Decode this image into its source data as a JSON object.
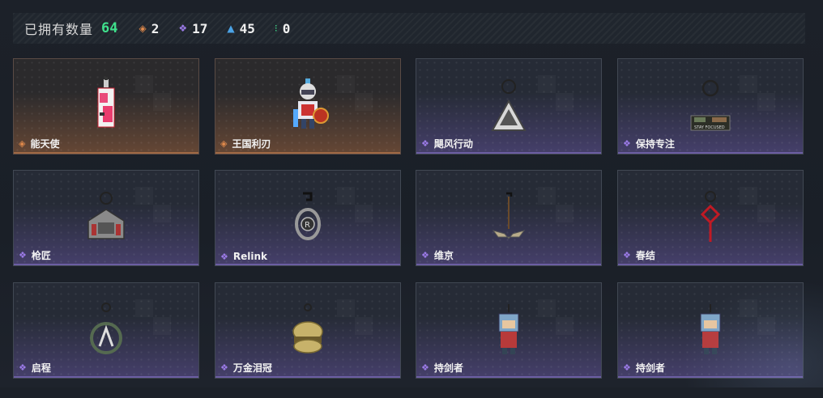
{
  "header": {
    "owned_label": "已拥有数量",
    "owned_count": "64",
    "rarities": [
      {
        "icon": "orange-diamond-icon",
        "glyph": "◈",
        "color": "#e08a4c",
        "count": "2"
      },
      {
        "icon": "purple-diamond-icon",
        "glyph": "❖",
        "color": "#9c7be8",
        "count": "17"
      },
      {
        "icon": "blue-triangle-icon",
        "glyph": "▲",
        "color": "#4ba3e6",
        "count": "45"
      },
      {
        "icon": "green-dots-icon",
        "glyph": "⁝",
        "color": "#3fe08c",
        "count": "0"
      }
    ]
  },
  "items": [
    {
      "name": "能天使",
      "rarity": "orange"
    },
    {
      "name": "王国利刃",
      "rarity": "orange"
    },
    {
      "name": "飓风行动",
      "rarity": "purple"
    },
    {
      "name": "保持专注",
      "rarity": "purple"
    },
    {
      "name": "枪匠",
      "rarity": "purple"
    },
    {
      "name": "Relink",
      "rarity": "purple"
    },
    {
      "name": "维京",
      "rarity": "purple"
    },
    {
      "name": "春结",
      "rarity": "purple"
    },
    {
      "name": "启程",
      "rarity": "purple"
    },
    {
      "name": "万金泪冠",
      "rarity": "purple"
    },
    {
      "name": "持剑者",
      "rarity": "purple"
    },
    {
      "name": "持剑者",
      "rarity": "purple"
    }
  ]
}
